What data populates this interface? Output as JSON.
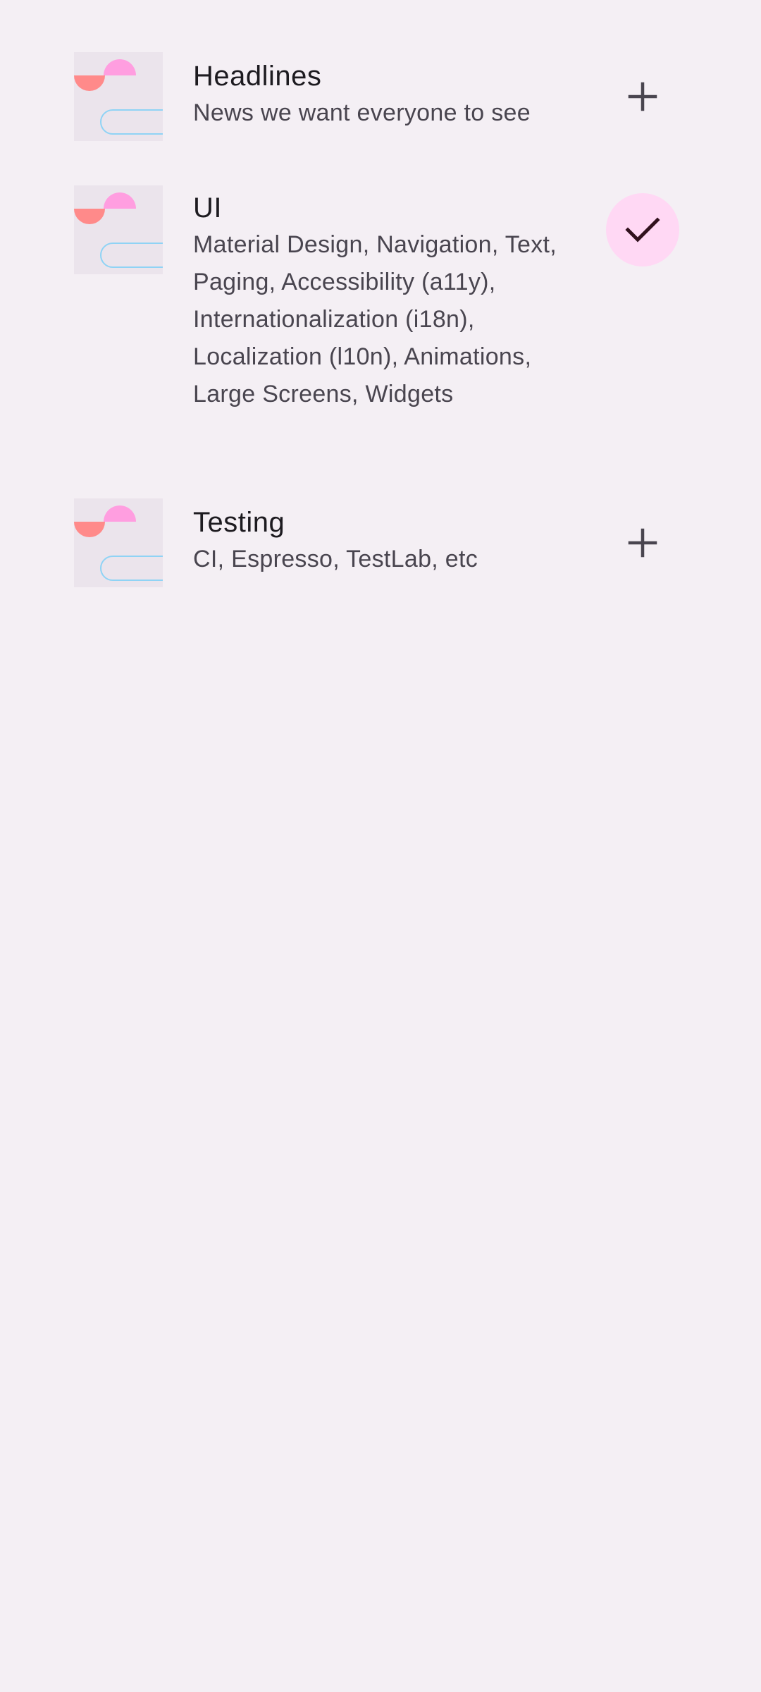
{
  "colors": {
    "background": "#f4eff4",
    "thumbnail_background": "#ebe4ec",
    "title_text": "#1d1b20",
    "description_text": "#49454f",
    "selected_button": "#ffd8f4",
    "check_icon": "#31111d",
    "add_icon": "#49454f"
  },
  "topics": [
    {
      "title": "Headlines",
      "description": "News we want everyone to see",
      "followed": false,
      "action_icon": "add-icon"
    },
    {
      "title": "UI",
      "description": "Material Design, Navigation, Text, Paging, Accessibility (a11y), Internationalization (i18n), Localization (l10n), Animations, Large Screens, Widgets",
      "followed": true,
      "action_icon": "check-icon"
    },
    {
      "title": "Testing",
      "description": "CI, Espresso, TestLab, etc",
      "followed": false,
      "action_icon": "add-icon"
    }
  ]
}
